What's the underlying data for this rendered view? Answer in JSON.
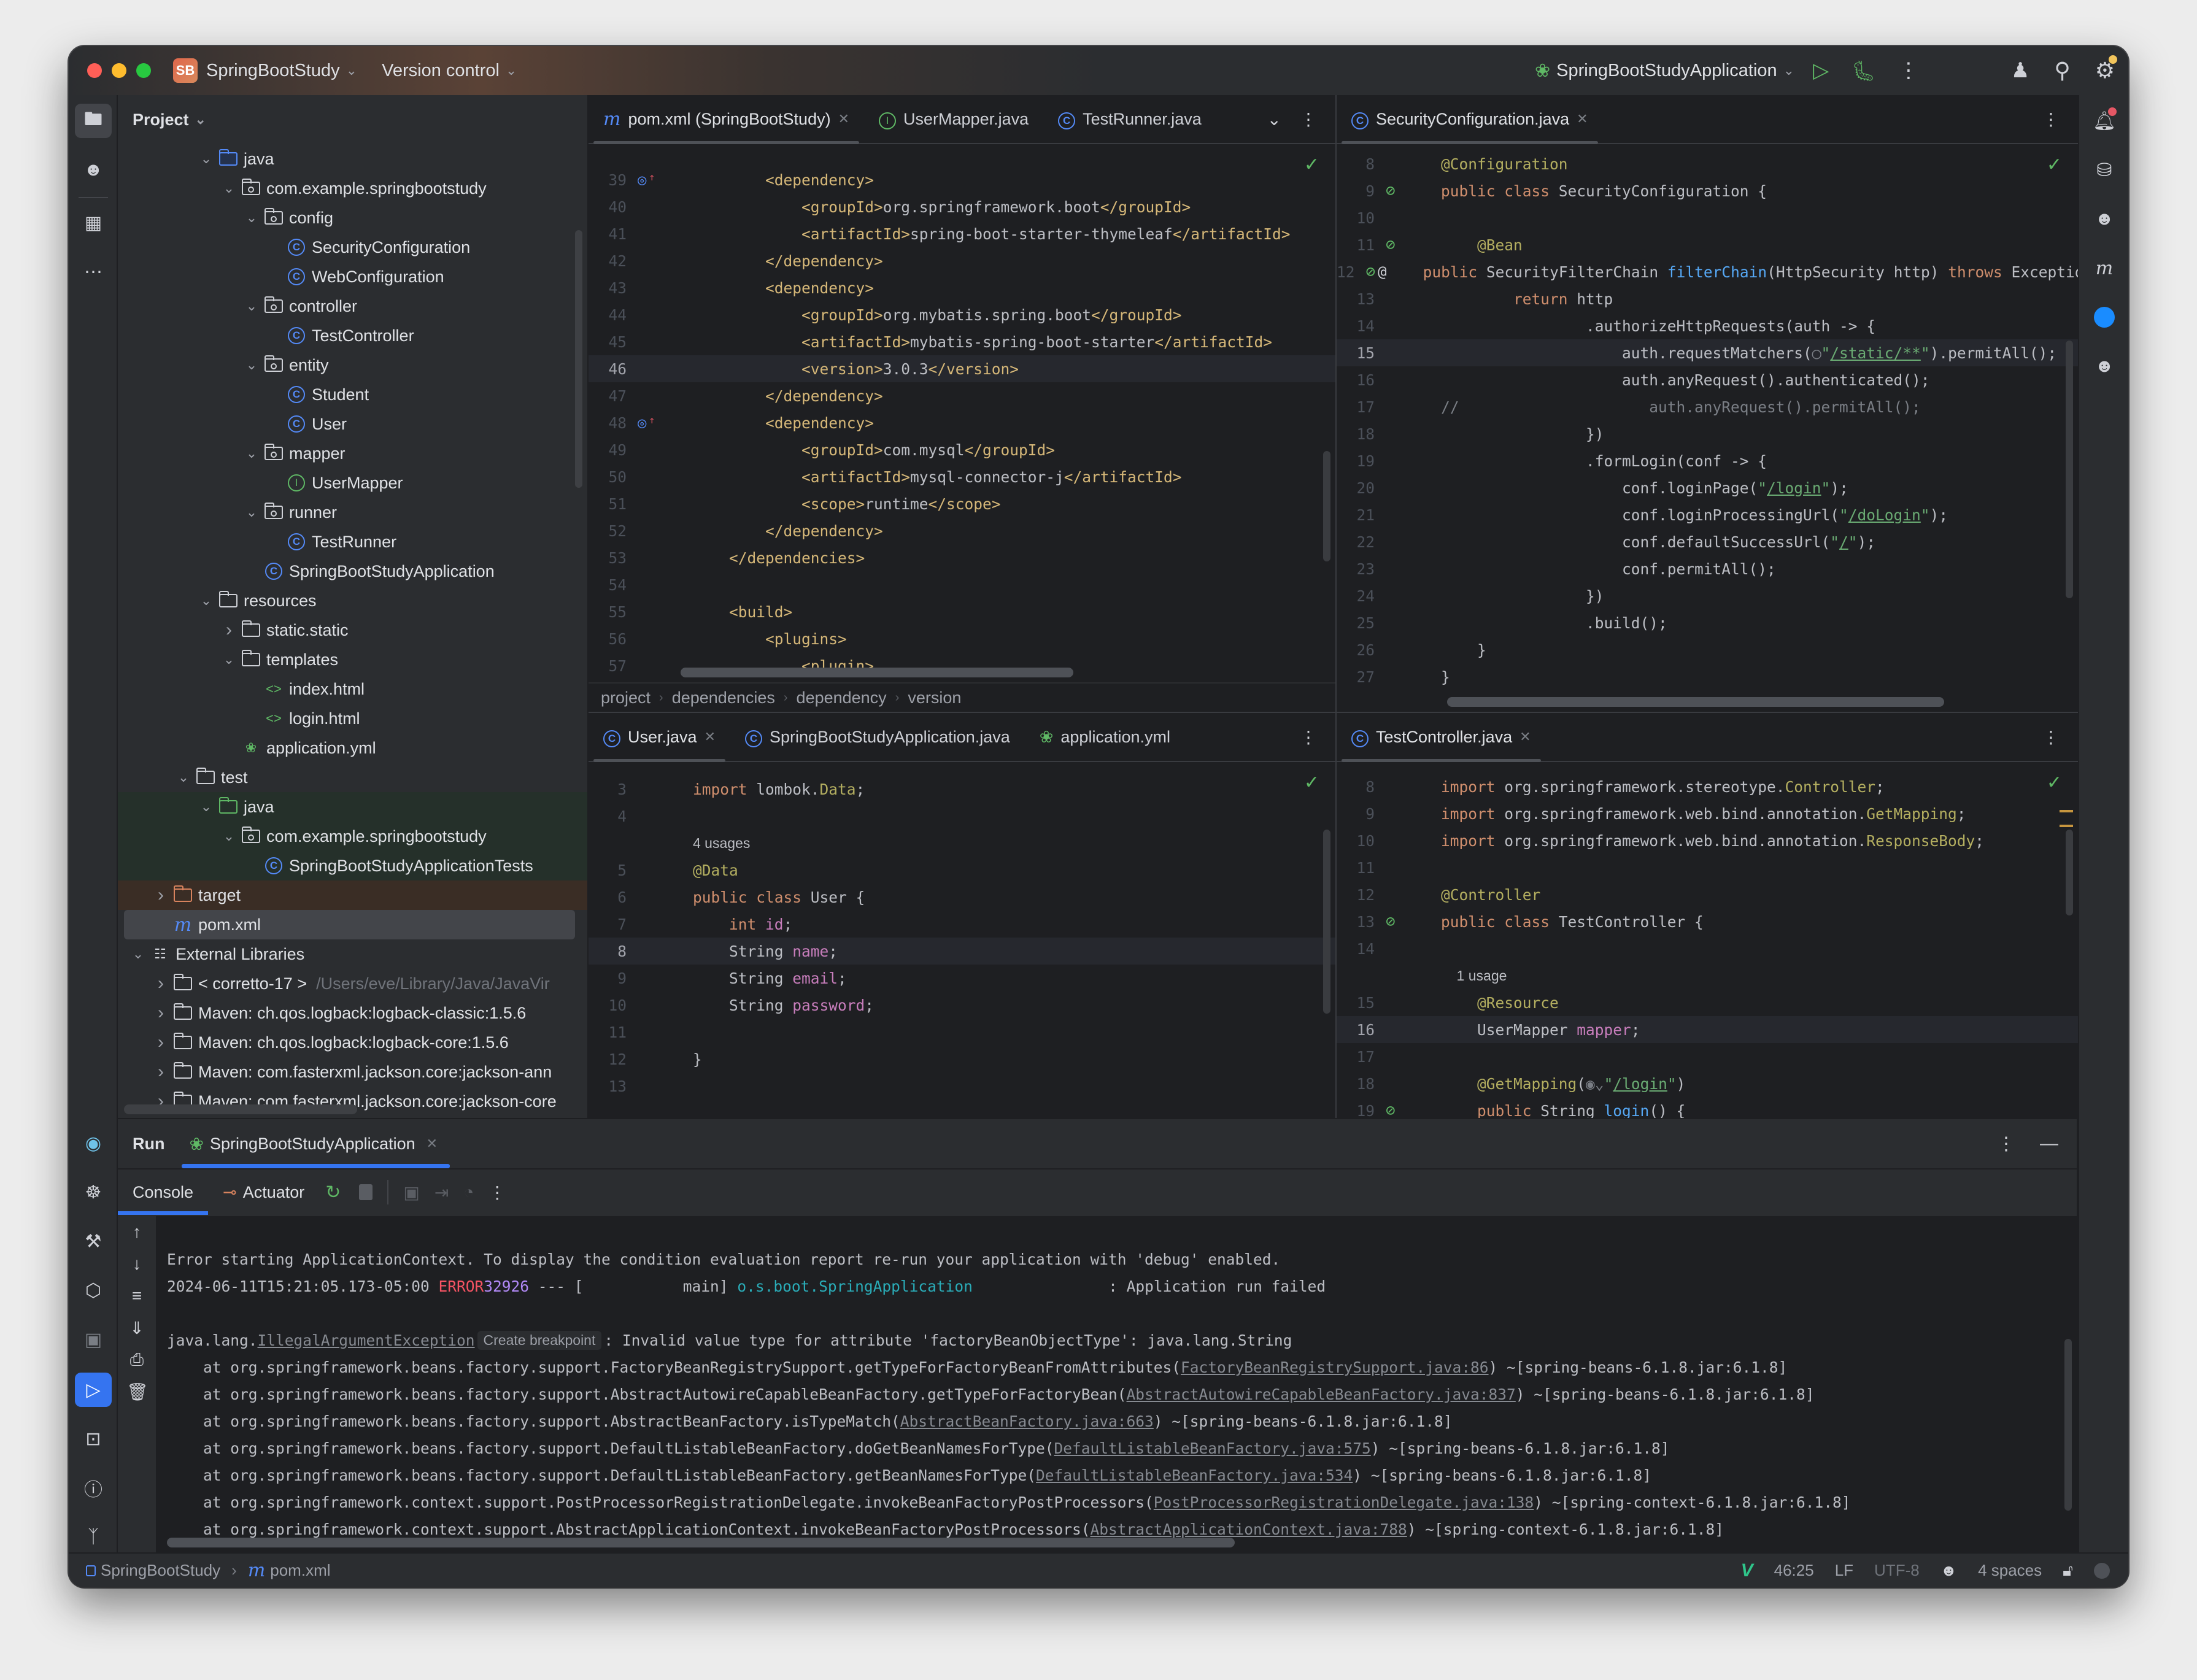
{
  "titlebar": {
    "project_badge": "SB",
    "project_name": "SpringBootStudy",
    "version_control": "Version control",
    "run_config": "SpringBootStudyApplication"
  },
  "project_panel": {
    "title": "Project",
    "tree": [
      {
        "depth": 3,
        "expanded": true,
        "icon": "folder-blue",
        "label": "java"
      },
      {
        "depth": 4,
        "expanded": true,
        "icon": "package",
        "label": "com.example.springbootstudy"
      },
      {
        "depth": 5,
        "expanded": true,
        "icon": "package",
        "label": "config"
      },
      {
        "depth": 6,
        "icon": "class",
        "label": "SecurityConfiguration"
      },
      {
        "depth": 6,
        "icon": "class",
        "label": "WebConfiguration"
      },
      {
        "depth": 5,
        "expanded": true,
        "icon": "package",
        "label": "controller"
      },
      {
        "depth": 6,
        "icon": "class",
        "label": "TestController"
      },
      {
        "depth": 5,
        "expanded": true,
        "icon": "package",
        "label": "entity"
      },
      {
        "depth": 6,
        "icon": "class",
        "label": "Student"
      },
      {
        "depth": 6,
        "icon": "class",
        "label": "User"
      },
      {
        "depth": 5,
        "expanded": true,
        "icon": "package",
        "label": "mapper"
      },
      {
        "depth": 6,
        "icon": "interface",
        "label": "UserMapper"
      },
      {
        "depth": 5,
        "expanded": true,
        "icon": "package",
        "label": "runner"
      },
      {
        "depth": 6,
        "icon": "class",
        "label": "TestRunner"
      },
      {
        "depth": 5,
        "icon": "spring-class",
        "label": "SpringBootStudyApplication"
      },
      {
        "depth": 3,
        "expanded": true,
        "icon": "resources",
        "label": "resources"
      },
      {
        "depth": 4,
        "expanded": false,
        "icon": "folder",
        "label": "static.static"
      },
      {
        "depth": 4,
        "expanded": true,
        "icon": "folder",
        "label": "templates"
      },
      {
        "depth": 5,
        "icon": "html",
        "label": "index.html"
      },
      {
        "depth": 5,
        "icon": "html",
        "label": "login.html"
      },
      {
        "depth": 4,
        "icon": "spring-yml",
        "label": "application.yml"
      },
      {
        "depth": 2,
        "expanded": true,
        "icon": "folder",
        "label": "test"
      },
      {
        "depth": 3,
        "expanded": true,
        "icon": "folder-green",
        "label": "java",
        "highlight": "test"
      },
      {
        "depth": 4,
        "expanded": true,
        "icon": "package",
        "label": "com.example.springbootstudy",
        "highlight": "test"
      },
      {
        "depth": 5,
        "icon": "class",
        "label": "SpringBootStudyApplicationTests",
        "highlight": "test"
      },
      {
        "depth": 1,
        "expanded": false,
        "icon": "folder-orange",
        "label": "target",
        "highlight": "excluded"
      },
      {
        "depth": 1,
        "icon": "maven",
        "label": "pom.xml",
        "selected": true
      },
      {
        "depth": 0,
        "expanded": true,
        "icon": "library",
        "label": "External Libraries"
      },
      {
        "depth": 1,
        "expanded": false,
        "icon": "jdk",
        "label": "< corretto-17 >",
        "hint": "/Users/eve/Library/Java/JavaVir"
      },
      {
        "depth": 1,
        "expanded": false,
        "icon": "lib",
        "label": "Maven: ch.qos.logback:logback-classic:1.5.6"
      },
      {
        "depth": 1,
        "expanded": false,
        "icon": "lib",
        "label": "Maven: ch.qos.logback:logback-core:1.5.6"
      },
      {
        "depth": 1,
        "expanded": false,
        "icon": "lib",
        "label": "Maven: com.fasterxml.jackson.core:jackson-ann"
      },
      {
        "depth": 1,
        "expanded": false,
        "icon": "lib",
        "label": "Maven: com.fasterxml.jackson.core:jackson-core"
      }
    ]
  },
  "editor_tl": {
    "tabs": [
      {
        "label": "pom.xml (SpringBootStudy)",
        "icon": "maven",
        "active": true,
        "closable": true
      },
      {
        "label": "UserMapper.java",
        "icon": "interface"
      },
      {
        "label": "TestRunner.java",
        "icon": "class"
      }
    ],
    "breadcrumbs": [
      "project",
      "dependencies",
      "dependency",
      "version"
    ],
    "lines": [
      {
        "n": "39",
        "gutter": "maven-override",
        "html": "        <span class='t'>&lt;dependency&gt;</span>"
      },
      {
        "n": "40",
        "html": "            <span class='t'>&lt;groupId&gt;</span>org.springframework.boot<span class='t'>&lt;/groupId&gt;</span>"
      },
      {
        "n": "41",
        "html": "            <span class='t'>&lt;artifactId&gt;</span>spring-boot-starter-thymeleaf<span class='t'>&lt;/artifactId&gt;</span>"
      },
      {
        "n": "42",
        "html": "        <span class='t'>&lt;/dependency&gt;</span>"
      },
      {
        "n": "43",
        "html": "        <span class='t'>&lt;dependency&gt;</span>"
      },
      {
        "n": "44",
        "html": "            <span class='t'>&lt;groupId&gt;</span>org.mybatis.spring.boot<span class='t'>&lt;/groupId&gt;</span>"
      },
      {
        "n": "45",
        "html": "            <span class='t'>&lt;artifactId&gt;</span>mybatis-spring-boot-starter<span class='t'>&lt;/artifactId&gt;</span>"
      },
      {
        "n": "46",
        "cur": true,
        "html": "            <span class='t'>&lt;version&gt;</span>3.0.3<span class='t'>&lt;/version&gt;</span>"
      },
      {
        "n": "47",
        "html": "        <span class='t'>&lt;/dependency&gt;</span>"
      },
      {
        "n": "48",
        "gutter": "maven-override",
        "html": "        <span class='t'>&lt;dependency&gt;</span>"
      },
      {
        "n": "49",
        "html": "            <span class='t'>&lt;groupId&gt;</span>com.mysql<span class='t'>&lt;/groupId&gt;</span>"
      },
      {
        "n": "50",
        "html": "            <span class='t'>&lt;artifactId&gt;</span>mysql-connector-j<span class='t'>&lt;/artifactId&gt;</span>"
      },
      {
        "n": "51",
        "html": "            <span class='t'>&lt;scope&gt;</span>runtime<span class='t'>&lt;/scope&gt;</span>"
      },
      {
        "n": "52",
        "html": "        <span class='t'>&lt;/dependency&gt;</span>"
      },
      {
        "n": "53",
        "html": "    <span class='t'>&lt;/dependencies&gt;</span>"
      },
      {
        "n": "54",
        "html": ""
      },
      {
        "n": "55",
        "html": "    <span class='t'>&lt;build&gt;</span>"
      },
      {
        "n": "56",
        "html": "        <span class='t'>&lt;plugins&gt;</span>"
      },
      {
        "n": "57",
        "html": "            <span class='t'>&lt;plugin&gt;</span>"
      }
    ]
  },
  "editor_tr": {
    "tabs": [
      {
        "label": "SecurityConfiguration.java",
        "icon": "class",
        "active": true,
        "closable": true
      }
    ],
    "lines": [
      {
        "n": "8",
        "html": "<span class='a'>@Configuration</span>"
      },
      {
        "n": "9",
        "gutter": "bean",
        "html": "<span class='k'>public class</span> SecurityConfiguration {"
      },
      {
        "n": "10",
        "html": ""
      },
      {
        "n": "11",
        "gutter": "bean",
        "html": "    <span class='a'>@Bean</span>"
      },
      {
        "n": "12",
        "gutter": "bean-at",
        "html": "    <span class='k'>public</span> SecurityFilterChain <span class='f'>filterChain</span>(HttpSecurity http) <span class='k'>throws</span> Exception {"
      },
      {
        "n": "13",
        "html": "        <span class='k'>return</span> http"
      },
      {
        "n": "14",
        "html": "                .authorizeHttpRequests(auth -&gt; {"
      },
      {
        "n": "15",
        "cur": true,
        "html": "                    auth.requestMatchers(<span class='c'>&#9711;</span><span class='s'>\"<span class='u'>/static/**</span>\"</span>).permitAll();"
      },
      {
        "n": "16",
        "html": "                    auth.anyRequest().authenticated();"
      },
      {
        "n": "17",
        "html": "<span class='c'>//                     auth.anyRequest().permitAll();</span>"
      },
      {
        "n": "18",
        "html": "                })"
      },
      {
        "n": "19",
        "html": "                .formLogin(conf -&gt; {"
      },
      {
        "n": "20",
        "html": "                    conf.loginPage(<span class='s'>\"<span class='u'>/login</span>\"</span>);"
      },
      {
        "n": "21",
        "html": "                    conf.loginProcessingUrl(<span class='s'>\"<span class='u'>/doLogin</span>\"</span>);"
      },
      {
        "n": "22",
        "html": "                    conf.defaultSuccessUrl(<span class='s'>\"<span class='u'>/</span>\"</span>);"
      },
      {
        "n": "23",
        "html": "                    conf.permitAll();"
      },
      {
        "n": "24",
        "html": "                })"
      },
      {
        "n": "25",
        "html": "                .build();"
      },
      {
        "n": "26",
        "html": "    }"
      },
      {
        "n": "27",
        "html": "}"
      }
    ]
  },
  "editor_bl": {
    "tabs": [
      {
        "label": "User.java",
        "icon": "class",
        "active": true,
        "closable": true
      },
      {
        "label": "SpringBootStudyApplication.java",
        "icon": "spring-class"
      },
      {
        "label": "application.yml",
        "icon": "spring-yml"
      }
    ],
    "usages_hint": "4 usages",
    "lines": [
      {
        "n": "3",
        "html": "<span class='k'>import</span> lombok.<span class='a'>Data</span>;"
      },
      {
        "n": "4",
        "html": ""
      },
      {
        "n": "",
        "usage": true,
        "html": "4 usages"
      },
      {
        "n": "5",
        "html": "<span class='a'>@Data</span>"
      },
      {
        "n": "6",
        "html": "<span class='k'>public class</span> User {"
      },
      {
        "n": "7",
        "html": "    <span class='k'>int</span> <span class='p'>id</span>;"
      },
      {
        "n": "8",
        "cur": true,
        "html": "    String <span class='p'>name</span>;"
      },
      {
        "n": "9",
        "html": "    String <span class='p'>email</span>;"
      },
      {
        "n": "10",
        "html": "    String <span class='p'>password</span>;"
      },
      {
        "n": "11",
        "html": ""
      },
      {
        "n": "12",
        "html": "}"
      },
      {
        "n": "13",
        "html": ""
      }
    ]
  },
  "editor_br": {
    "tabs": [
      {
        "label": "TestController.java",
        "icon": "class",
        "active": true,
        "closable": true
      }
    ],
    "lines": [
      {
        "n": "8",
        "html": "<span class='k'>import</span> org.springframework.stereotype.<span class='a'>Controller</span>;"
      },
      {
        "n": "9",
        "html": "<span class='k'>import</span> org.springframework.web.bind.annotation.<span class='a'>GetMapping</span>;"
      },
      {
        "n": "10",
        "html": "<span class='k'>import</span> org.springframework.web.bind.annotation.<span class='a'>ResponseBody</span>;"
      },
      {
        "n": "11",
        "html": ""
      },
      {
        "n": "12",
        "html": "<span class='a'>@Controller</span>"
      },
      {
        "n": "13",
        "gutter": "bean",
        "html": "<span class='k'>public class</span> TestController {"
      },
      {
        "n": "14",
        "html": ""
      },
      {
        "n": "",
        "usage": true,
        "html": "    1 usage"
      },
      {
        "n": "15",
        "html": "    <span class='a'>@Resource</span>"
      },
      {
        "n": "16",
        "cur": true,
        "html": "    UserMapper <span class='p'>mapper</span>;"
      },
      {
        "n": "17",
        "html": ""
      },
      {
        "n": "18",
        "html": "    <span class='a'>@GetMapping</span>(<span class='c'>&#9673;&#8964;</span><span class='s'>\"<span class='u'>/login</span>\"</span>)"
      },
      {
        "n": "19",
        "gutter": "bean-web",
        "html": "    <span class='k'>public</span> String <span class='f'>login</span>() {"
      }
    ]
  },
  "run_panel": {
    "title": "Run",
    "config_tab": "SpringBootStudyApplication",
    "console_tab": "Console",
    "actuator_tab": "Actuator",
    "create_breakpoint": "Create breakpoint",
    "lines": [
      {
        "html": ""
      },
      {
        "html": "Error starting ApplicationContext. To display the condition evaluation report re-run your application with 'debug' enabled."
      },
      {
        "html": "2024-06-11T15:21:05.173-05:00 <span class='err'>ERROR</span> <span class='pid'>32926</span> --- [           main] <span class='cy'>o.s.boot.SpringApplication              </span> : Application run failed"
      },
      {
        "html": ""
      },
      {
        "html": "java.lang.<span class='lnk'>IllegalArgumentException</span><span class='bp'>Create breakpoint</span>: Invalid value type for attribute 'factoryBeanObjectType': java.lang.String"
      },
      {
        "html": "    at org.springframework.beans.factory.support.FactoryBeanRegistrySupport.getTypeForFactoryBeanFromAttributes(<span class='lnk'>FactoryBeanRegistrySupport.java:86</span>) ~[spring-beans-6.1.8.jar:6.1.8]"
      },
      {
        "html": "    at org.springframework.beans.factory.support.AbstractAutowireCapableBeanFactory.getTypeForFactoryBean(<span class='lnk'>AbstractAutowireCapableBeanFactory.java:837</span>) ~[spring-beans-6.1.8.jar:6.1.8]"
      },
      {
        "html": "    at org.springframework.beans.factory.support.AbstractBeanFactory.isTypeMatch(<span class='lnk'>AbstractBeanFactory.java:663</span>) ~[spring-beans-6.1.8.jar:6.1.8]"
      },
      {
        "html": "    at org.springframework.beans.factory.support.DefaultListableBeanFactory.doGetBeanNamesForType(<span class='lnk'>DefaultListableBeanFactory.java:575</span>) ~[spring-beans-6.1.8.jar:6.1.8]"
      },
      {
        "html": "    at org.springframework.beans.factory.support.DefaultListableBeanFactory.getBeanNamesForType(<span class='lnk'>DefaultListableBeanFactory.java:534</span>) ~[spring-beans-6.1.8.jar:6.1.8]"
      },
      {
        "html": "    at org.springframework.context.support.PostProcessorRegistrationDelegate.invokeBeanFactoryPostProcessors(<span class='lnk'>PostProcessorRegistrationDelegate.java:138</span>) ~[spring-context-6.1.8.jar:6.1.8]"
      },
      {
        "html": "    at org.springframework.context.support.AbstractApplicationContext.invokeBeanFactoryPostProcessors(<span class='lnk'>AbstractApplicationContext.java:788</span>) ~[spring-context-6.1.8.jar:6.1.8]"
      }
    ]
  },
  "status_bar": {
    "breadcrumb_project": "SpringBootStudy",
    "breadcrumb_file": "pom.xml",
    "position": "46:25",
    "line_sep": "LF",
    "encoding": "UTF-8",
    "indent": "4 spaces"
  },
  "colors": {
    "accent": "#3574f0",
    "error": "#f75464",
    "run_green": "#5fb865"
  }
}
